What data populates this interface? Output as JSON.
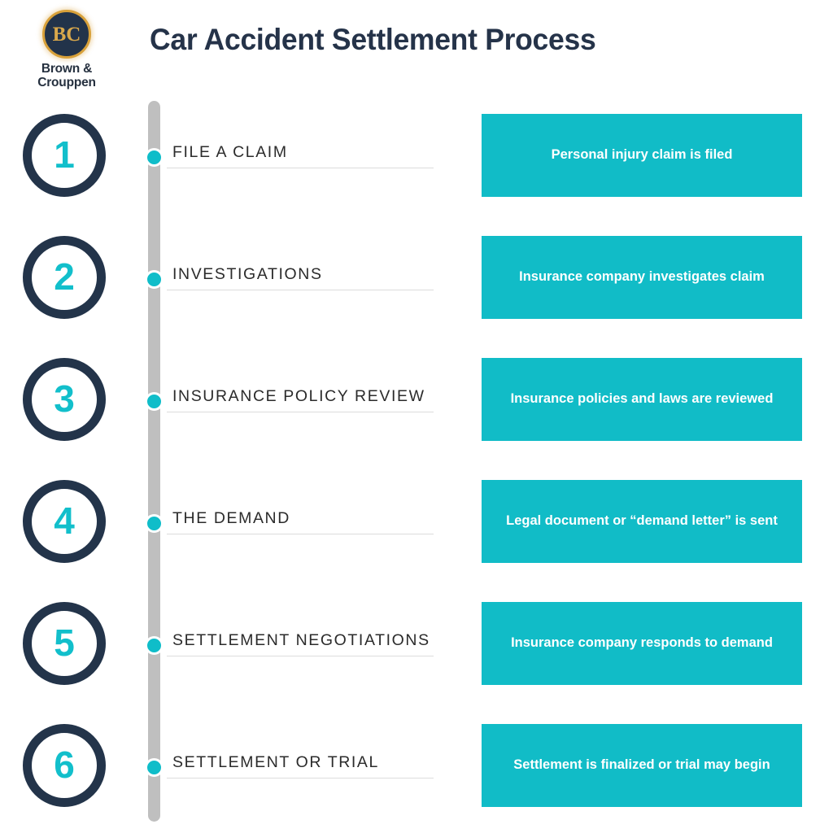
{
  "brand": {
    "badge_initials": "BC",
    "name_line1": "Brown &",
    "name_line2": "Crouppen"
  },
  "header": {
    "title": "Car Accident Settlement Process"
  },
  "colors": {
    "navy": "#23344a",
    "teal": "#11bcc7",
    "cyan_number": "#12bfcb",
    "track_gray": "#bfbfbf",
    "gold": "#d9a84b",
    "rule_gray": "#dcdcdc",
    "background": "#ffffff"
  },
  "steps": [
    {
      "number": "1",
      "label": "FILE A CLAIM",
      "description": "Personal injury claim is filed"
    },
    {
      "number": "2",
      "label": "INVESTIGATIONS",
      "description": "Insurance company investigates claim"
    },
    {
      "number": "3",
      "label": "INSURANCE POLICY REVIEW",
      "description": "Insurance policies and laws are reviewed"
    },
    {
      "number": "4",
      "label": "THE DEMAND",
      "description": "Legal document or “demand letter” is sent"
    },
    {
      "number": "5",
      "label": "SETTLEMENT NEGOTIATIONS",
      "description": "Insurance company responds to demand"
    },
    {
      "number": "6",
      "label": "SETTLEMENT OR TRIAL",
      "description": "Settlement is finalized or trial may begin"
    }
  ]
}
